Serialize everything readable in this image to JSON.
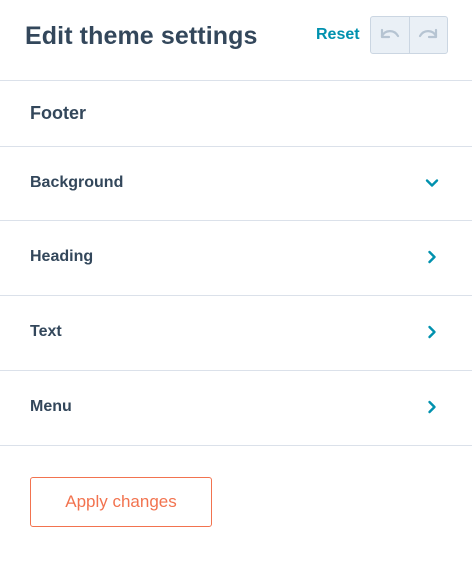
{
  "header": {
    "title": "Edit theme settings",
    "reset_label": "Reset",
    "undo_icon": "undo-icon",
    "redo_icon": "redo-icon"
  },
  "section": {
    "title": "Footer"
  },
  "accordion": [
    {
      "label": "Background",
      "state": "expanded",
      "icon": "chevron-down-icon"
    },
    {
      "label": "Heading",
      "state": "collapsed",
      "icon": "chevron-right-icon"
    },
    {
      "label": "Text",
      "state": "collapsed",
      "icon": "chevron-right-icon"
    },
    {
      "label": "Menu",
      "state": "collapsed",
      "icon": "chevron-right-icon"
    }
  ],
  "footer": {
    "apply_label": "Apply changes"
  },
  "colors": {
    "accent": "#0091ae",
    "text": "#33475b",
    "divider": "#dbe1ea",
    "apply": "#f2734f"
  }
}
